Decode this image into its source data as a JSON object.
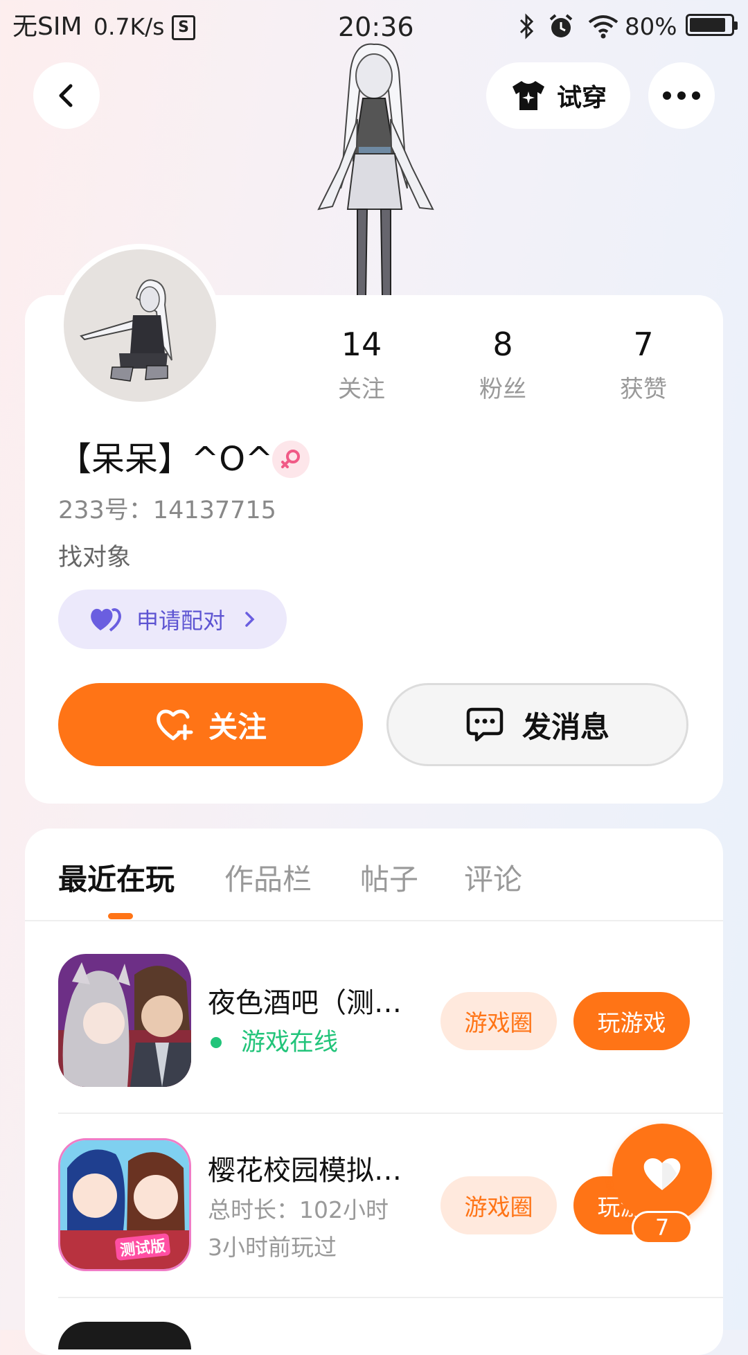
{
  "status_bar": {
    "carrier": "无SIM",
    "speed": "0.7K/s",
    "time": "20:36",
    "battery": "80%"
  },
  "header": {
    "try_on_label": "试穿"
  },
  "profile": {
    "stats": [
      {
        "value": "14",
        "label": "关注"
      },
      {
        "value": "8",
        "label": "粉丝"
      },
      {
        "value": "7",
        "label": "获赞"
      }
    ],
    "name": "【呆呆】^O^",
    "gender_icon": "female-icon",
    "id_text": "233号：14137715",
    "bio": "找对象",
    "pair_label": "申请配对",
    "follow_label": "关注",
    "message_label": "发消息"
  },
  "tabs": [
    {
      "label": "最近在玩",
      "active": true
    },
    {
      "label": "作品栏",
      "active": false
    },
    {
      "label": "帖子",
      "active": false
    },
    {
      "label": "评论",
      "active": false
    }
  ],
  "games": [
    {
      "title": "夜色酒吧（测…",
      "status": "游戏在线",
      "circle_label": "游戏圈",
      "play_label": "玩游戏"
    },
    {
      "title": "樱花校园模拟…",
      "duration": "总时长：102小时",
      "last_played": "3小时前玩过",
      "badge": "测试版",
      "circle_label": "游戏圈",
      "play_label": "玩游戏"
    }
  ],
  "floating_like": {
    "count": "7"
  },
  "colors": {
    "accent": "#ff7416",
    "accent_light": "#ffe9dd",
    "pair_bg": "#ece9fb",
    "pair_text": "#5d54d2",
    "online_green": "#22c47a"
  }
}
